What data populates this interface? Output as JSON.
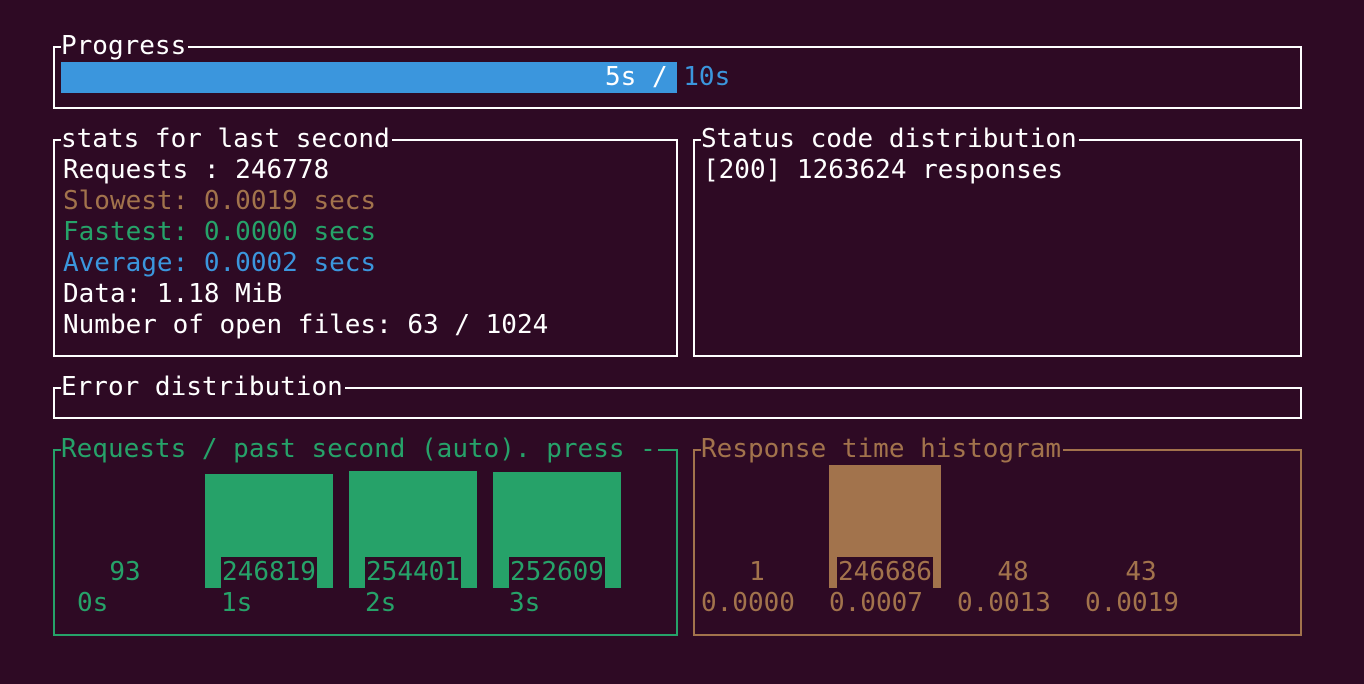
{
  "colors": {
    "background": "#2e0a24",
    "progress": "#3b96dd",
    "slowest": "#a2734c",
    "fastest": "#26a269",
    "average": "#3b96dd",
    "requests_chart": "#26a269",
    "histogram": "#a2734c"
  },
  "progress": {
    "title": "Progress",
    "label_done": "5s / ",
    "label_total": "10s",
    "fraction": 0.5
  },
  "stats": {
    "title": "stats for last second",
    "requests": "Requests : 246778",
    "slowest": "Slowest: 0.0019 secs",
    "fastest": "Fastest: 0.0000 secs",
    "average": "Average: 0.0002 secs",
    "data": "Data: 1.18 MiB",
    "open_files": "Number of open files: 63 / 1024"
  },
  "status": {
    "title": "Status code distribution",
    "lines": [
      "[200] 1263624 responses"
    ]
  },
  "errors": {
    "title": "Error distribution"
  },
  "chart_data": [
    {
      "type": "bar",
      "title": "Requests / past second (auto). press -",
      "categories": [
        "0s",
        "1s",
        "2s",
        "3s"
      ],
      "values": [
        93,
        246819,
        254401,
        252609
      ]
    },
    {
      "type": "bar",
      "title": "Response time histogram",
      "categories": [
        "0.0000",
        "0.0007",
        "0.0013",
        "0.0019"
      ],
      "values": [
        1,
        246686,
        48,
        43
      ]
    }
  ]
}
